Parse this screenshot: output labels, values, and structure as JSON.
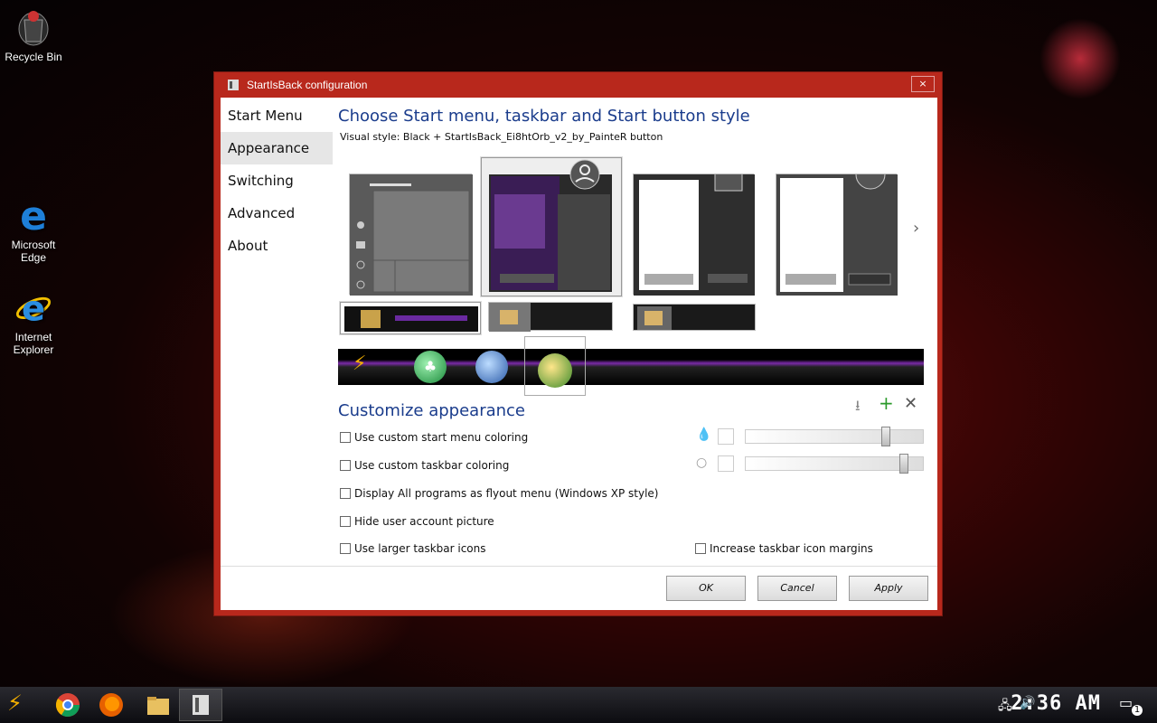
{
  "desktop": {
    "icons": [
      {
        "label": "Recycle Bin"
      },
      {
        "label": "Microsoft Edge"
      },
      {
        "label": "Internet\nExplorer"
      }
    ]
  },
  "window": {
    "title": "StartIsBack configuration",
    "close_label": "×",
    "nav": [
      {
        "label": "Start Menu"
      },
      {
        "label": "Appearance"
      },
      {
        "label": "Switching"
      },
      {
        "label": "Advanced"
      },
      {
        "label": "About"
      }
    ],
    "active_nav": "Appearance",
    "heading": "Choose Start menu, taskbar and Start button style",
    "visual_style": "Visual style:  Black + StartIsBack_Ei8htOrb_v2_by_PainteR button",
    "customize_heading": "Customize appearance",
    "options": [
      {
        "label": "Use custom start menu coloring",
        "checked": false
      },
      {
        "label": "Use custom taskbar coloring",
        "checked": false
      },
      {
        "label": "Display All programs as flyout menu (Windows XP style)",
        "checked": false
      },
      {
        "label": "Hide user account picture",
        "checked": false
      },
      {
        "label": "Use larger taskbar icons",
        "checked": false
      },
      {
        "label": "Increase taskbar icon margins",
        "checked": false
      }
    ],
    "sliders": [
      {
        "name": "start-menu-opacity",
        "value_fraction": 0.78
      },
      {
        "name": "taskbar-opacity",
        "value_fraction": 0.88
      }
    ],
    "buttons": {
      "ok": "OK",
      "cancel": "Cancel",
      "apply": "Apply"
    }
  },
  "taskbar": {
    "clock": "2:36 AM",
    "notification_count": "1"
  },
  "colors": {
    "window_frame": "#b8281c",
    "heading_blue": "#1a3c8c",
    "purple_accent": "#7a2aa8"
  }
}
